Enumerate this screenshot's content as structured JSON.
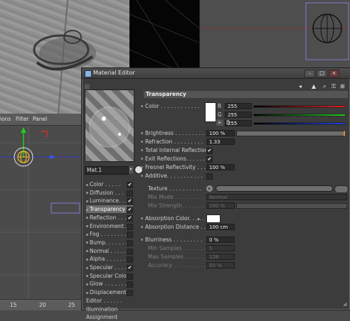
{
  "viewport_menu": {
    "item1": "ions",
    "item2": "Filter",
    "item3": "Panel"
  },
  "ruler": {
    "t1": "15",
    "t2": "20",
    "t3": "25"
  },
  "window": {
    "title": "Material Editor"
  },
  "material": {
    "name": "Mat.1"
  },
  "channels": [
    {
      "label": "Color . . . . .",
      "checked": "✔"
    },
    {
      "label": "Diffusion . . .",
      "checked": ""
    },
    {
      "label": "Luminance. . .",
      "checked": "✔"
    },
    {
      "label": "Transparency",
      "checked": "✔"
    },
    {
      "label": "Reflection . . .",
      "checked": "✔"
    },
    {
      "label": "Environment . .",
      "checked": ""
    },
    {
      "label": "Fog . . . . . . . .",
      "checked": ""
    },
    {
      "label": "Bump. . . . . . .",
      "checked": ""
    },
    {
      "label": "Normal . . . . .",
      "checked": ""
    },
    {
      "label": "Alpha . . . . . .",
      "checked": ""
    },
    {
      "label": "Specular . . . .",
      "checked": "✔"
    },
    {
      "label": "Specular Color",
      "checked": ""
    },
    {
      "label": "Glow . . . . . . .",
      "checked": ""
    },
    {
      "label": "Displacement .",
      "checked": ""
    },
    {
      "label": "Editor . . . . . .",
      "checked": null
    },
    {
      "label": "Illumination",
      "checked": null
    },
    {
      "label": "Assignment",
      "checked": null
    }
  ],
  "section": {
    "title": "Transparency"
  },
  "props": {
    "color_label": "Color . . . . . . . . . . . .",
    "r_label": "R",
    "g_label": "G",
    "b_label": "B",
    "r_val": "255",
    "g_val": "255",
    "b_val": "255",
    "brightness_label": "Brightness . . . . . . . . .",
    "brightness_val": "100 %",
    "refraction_label": "Refraction . . . . . . . . .",
    "refraction_val": "1.33",
    "tir_label": "Total Internal Reflection",
    "tir_check": "✔",
    "exit_label": "Exit Reflections. . . . . .",
    "exit_check": "✔",
    "fresnel_label": "Fresnel Reflectivity . . .",
    "fresnel_val": "100 %",
    "additive_label": "Additive. . . . . . . . . . .",
    "additive_check": "",
    "texture_label": "Texture . . . . . . . . . .",
    "mixmode_label": "Mix Mode . . . . . . . . .",
    "mixmode_val": "Normal",
    "mixstrength_label": "Mix Strength. . . . . . . .",
    "mixstrength_val": "100 %",
    "abs_color_label": "Absorption Color. . . . .",
    "abs_dist_label": "Absorption Distance . . .",
    "abs_dist_val": "100 cm",
    "blur_label": "Blurriness . . . . . . . . .",
    "blur_val": "0 %",
    "min_label": "Min Samples . . . . . . . .",
    "min_val": "5",
    "max_label": "Max Samples . . . . . . . .",
    "max_val": "128",
    "acc_label": "Accuracy . . . . . . . . . .",
    "acc_val": "50 %"
  },
  "colors": {
    "red": "#e02020",
    "green": "#20d020",
    "blue": "#2040e0",
    "accent": "#e09020"
  }
}
